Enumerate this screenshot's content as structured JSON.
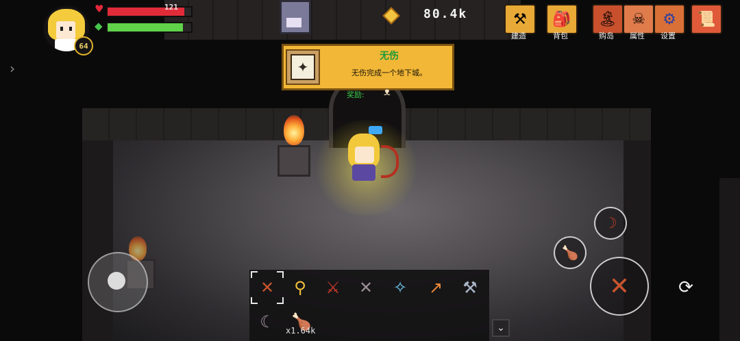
{
  "hud": {
    "level": "64",
    "hp_value": "121",
    "hp_fraction": 0.92,
    "energy_fraction": 0.9,
    "currency": "80.4k"
  },
  "menu": [
    {
      "label": "建造",
      "icon": "anvil-icon",
      "color": "#e9a936"
    },
    {
      "label": "背包",
      "icon": "backpack-icon",
      "color": "#e9a936"
    },
    {
      "label": "购岛",
      "icon": "island-icon",
      "color": "#c9502d"
    },
    {
      "label": "属性",
      "icon": "skull-scroll-icon",
      "color": "#e07b4b"
    },
    {
      "label": "设置",
      "icon": "gear-icon",
      "color": "#d97038"
    },
    {
      "label": "",
      "icon": "map-icon",
      "color": "#e05a3a"
    }
  ],
  "achievement": {
    "title": "无伤",
    "description": "无伤完成一个地下城。",
    "reward_label": "奖励:"
  },
  "hotbar": {
    "slots": [
      {
        "icon": "crossbow-icon",
        "selected": true
      },
      {
        "icon": "golden-shovel-icon"
      },
      {
        "icon": "red-sword-icon"
      },
      {
        "icon": "dark-crossbow-icon"
      },
      {
        "icon": "ice-spear-icon"
      },
      {
        "icon": "fire-torch-icon"
      },
      {
        "icon": "hammer-icon"
      }
    ],
    "row2": [
      {
        "icon": "bow-icon"
      },
      {
        "icon": "roast-meat-icon"
      }
    ],
    "food_count": "x1.64k"
  }
}
